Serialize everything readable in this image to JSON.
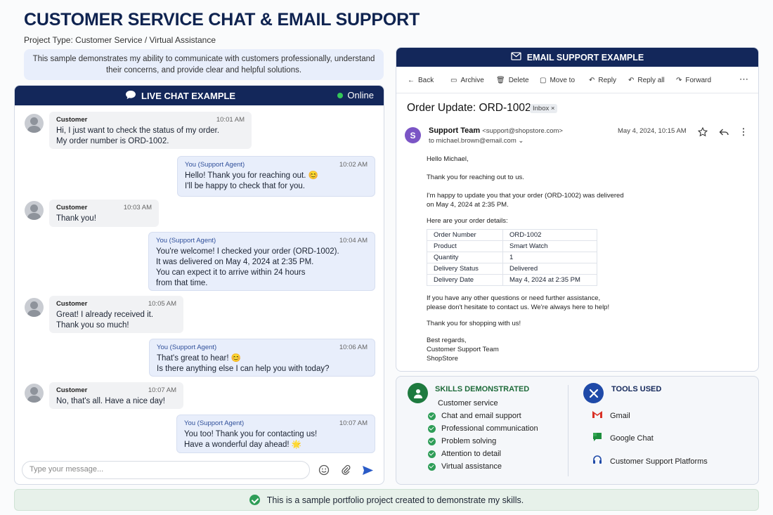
{
  "header": {
    "title": "CUSTOMER SERVICE CHAT & EMAIL SUPPORT",
    "subtitle": "Project Type: Customer Service / Virtual Assistance",
    "intro": "This sample demonstrates my ability to communicate with customers professionally, understand their concerns, and provide clear and helpful solutions."
  },
  "chat": {
    "title": "LIVE CHAT EXAMPLE",
    "status": "Online",
    "messages": [
      {
        "from": "Customer",
        "time": "10:01 AM",
        "text": "Hi, I just want to check the status of my order.\nMy order number is ORD-1002."
      },
      {
        "from": "You (Support Agent)",
        "time": "10:02 AM",
        "text": "Hello! Thank you for reaching out. 😊\nI'll be happy to check that for you."
      },
      {
        "from": "Customer",
        "time": "10:03 AM",
        "text": "Thank you!"
      },
      {
        "from": "You (Support Agent)",
        "time": "10:04 AM",
        "text": "You're welcome! I checked your order (ORD-1002).\nIt was delivered on May 4, 2024 at 2:35 PM.\nYou can expect it to arrive within 24 hours\nfrom that time."
      },
      {
        "from": "Customer",
        "time": "10:05 AM",
        "text": "Great! I already received it.\nThank you so much!"
      },
      {
        "from": "You (Support Agent)",
        "time": "10:06 AM",
        "text": "That's great to hear! 😊\nIs there anything else I can help you with today?"
      },
      {
        "from": "Customer",
        "time": "10:07 AM",
        "text": "No, that's all. Have a nice day!"
      },
      {
        "from": "You (Support Agent)",
        "time": "10:07 AM",
        "text": "You too! Thank you for contacting us!\nHave a wonderful day ahead! 🌟"
      }
    ],
    "input_placeholder": "Type your message..."
  },
  "email": {
    "title": "EMAIL SUPPORT EXAMPLE",
    "toolbar": {
      "back": "Back",
      "archive": "Archive",
      "delete": "Delete",
      "move": "Move to",
      "reply": "Reply",
      "reply_all": "Reply all",
      "forward": "Forward"
    },
    "subject": "Order Update: ORD-1002",
    "label": "Inbox",
    "sender_initial": "S",
    "sender_name": "Support Team",
    "sender_email": "<support@shopstore.com>",
    "to": "to michael.brown@email.com",
    "date": "May 4, 2024, 10:15 AM",
    "greeting": "Hello Michael,",
    "p1": "Thank you for reaching out to us.",
    "p2": "I'm happy to update you that your order (ORD-1002) was delivered\non May 4, 2024 at 2:35 PM.",
    "p3": "Here are your order details:",
    "order_table": [
      [
        "Order Number",
        "ORD-1002"
      ],
      [
        "Product",
        "Smart Watch"
      ],
      [
        "Quantity",
        "1"
      ],
      [
        "Delivery Status",
        "Delivered"
      ],
      [
        "Delivery Date",
        "May 4, 2024 at 2:35 PM"
      ]
    ],
    "p4": "If you have any other questions or need further assistance,\nplease don't hesitate to contact us. We're always here to help!",
    "p5": "Thank you for shopping with us!",
    "signature": "Best regards,\nCustomer Support Team\nShopStore"
  },
  "skills": {
    "title": "SKILLS DEMONSTRATED",
    "items": [
      "Customer service",
      "Chat and email support",
      "Professional communication",
      "Problem solving",
      "Attention to detail",
      "Virtual assistance"
    ]
  },
  "tools": {
    "title": "TOOLS USED",
    "items": [
      "Gmail",
      "Google Chat",
      "Customer Support Platforms"
    ]
  },
  "footer": "This is a sample portfolio project created to demonstrate my skills.",
  "colors": {
    "navy": "#13275a",
    "green": "#2e9d57",
    "agent_bubble": "#e8eefb"
  }
}
